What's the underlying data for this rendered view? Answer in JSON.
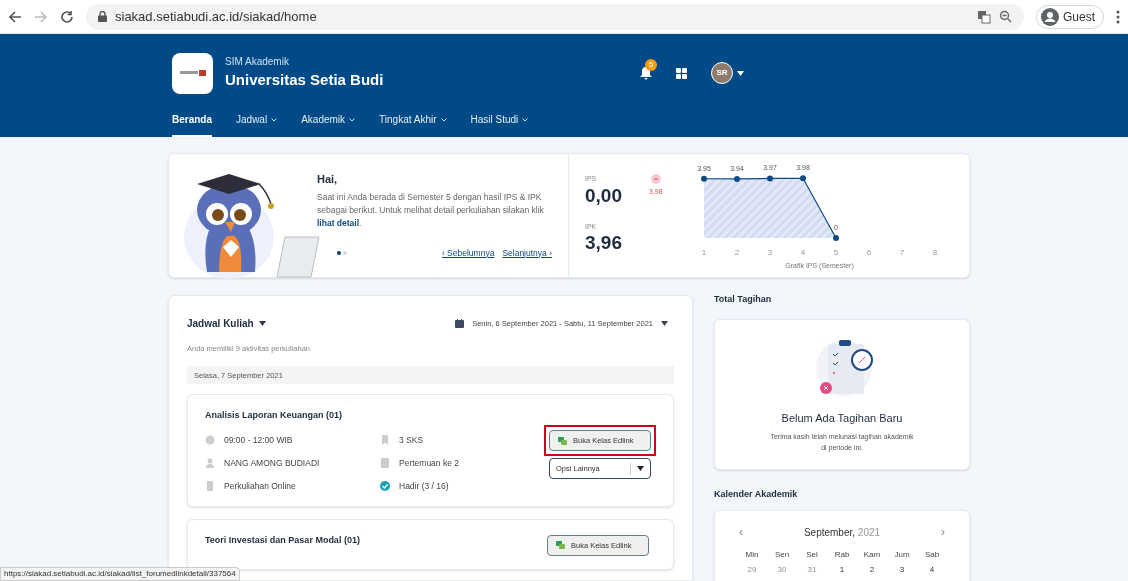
{
  "browser": {
    "url": "siakad.setiabudi.ac.id/siakad/home",
    "profile": "Guest"
  },
  "header": {
    "subtitle": "SIM Akademik",
    "title": "Universitas Setia Budi",
    "notification_count": "5",
    "avatar": "SR",
    "nav": [
      {
        "label": "Beranda",
        "selected": true,
        "dropdown": false
      },
      {
        "label": "Jadwal",
        "selected": false,
        "dropdown": true
      },
      {
        "label": "Akademik",
        "selected": false,
        "dropdown": true
      },
      {
        "label": "Tingkat Akhir",
        "selected": false,
        "dropdown": true
      },
      {
        "label": "Hasil Studi",
        "selected": false,
        "dropdown": true
      }
    ]
  },
  "greeting": {
    "hello": "Hai,",
    "message": "Saat ini Anda berada di Semester 5 dengan hasil IPS & IPK sebagai berikut. Untuk melihat detail perkuliahan silakan klik ",
    "link": "lihat detail",
    "message_end": ".",
    "slides": [
      {
        "selected": true
      },
      {
        "selected": false
      }
    ],
    "prev": "‹ Sebelumnya",
    "next": "Selanjutnya ›"
  },
  "stats": {
    "ips_label": "IPS",
    "ips": "0,00",
    "change": "3,98",
    "trend_down": true,
    "ipk_label": "IPK",
    "ipk": "3,96",
    "chart_data": {
      "type": "area",
      "xlabel": "Grafik IPS (Semester)",
      "x": [
        1,
        2,
        3,
        4,
        5
      ],
      "xticks": [
        1,
        2,
        3,
        4,
        5,
        6,
        7,
        8
      ],
      "xlim": [
        1,
        8
      ],
      "series": [
        {
          "color": "#0b4a85",
          "marker": "circle",
          "values": [
            3.95,
            3.94,
            3.97,
            3.98,
            0
          ]
        }
      ],
      "data_labels": true
    }
  },
  "schedule": {
    "title": "Jadwal Kuliah",
    "range": "Senin, 6 September 2021 - Sabtu, 11 September 2021",
    "summary": "Anda memiliki 9 aktivitas perkuliahan",
    "day": "Selasa, 7 September 2021",
    "courses": [
      {
        "title": "Analisis Laporan Keuangan (01)",
        "items": [
          {
            "kind": "time",
            "text": "09:00 - 12:00 WIB"
          },
          {
            "kind": "credits",
            "text": "3 SKS"
          },
          {
            "kind": "lecturer",
            "text": "NANG AMONG BUDIADI"
          },
          {
            "kind": "meeting",
            "text": "Pertemuan ke 2"
          },
          {
            "kind": "mode",
            "text": "Perkuliahan Online"
          },
          {
            "kind": "attendance",
            "text": "Hadir (3 / 16)"
          }
        ],
        "open_button": "Buka Kelas Edlink",
        "highlighted": true,
        "more": "Opsi Lainnya"
      },
      {
        "title": "Teori Investasi dan Pasar Modal (01)",
        "open_button": "Buka Kelas Edlink",
        "highlighted": false
      }
    ]
  },
  "billing": {
    "title": "Total Tagihan",
    "empty_title": "Belum Ada Tagihan Baru",
    "empty_text": "Terima kasih telah melunasi tagihan akademik di periode ini."
  },
  "calendar": {
    "title": "Kalender Akademik",
    "prev_button": "‹",
    "next_button": "›",
    "month": "September,",
    "year": "2021",
    "weekdays": [
      "Min",
      "Sen",
      "Sel",
      "Rab",
      "Kam",
      "Jum",
      "Sab"
    ],
    "days": [
      {
        "label": "29",
        "muted": true
      },
      {
        "label": "30",
        "muted": true
      },
      {
        "label": "31",
        "muted": true
      },
      {
        "label": "1",
        "muted": false
      },
      {
        "label": "2",
        "muted": false
      },
      {
        "label": "3",
        "muted": false
      },
      {
        "label": "4",
        "muted": false
      }
    ]
  },
  "status_url": "https://siakad.setiabudi.ac.id/siakad/list_forumedlinkdetail/337564"
}
